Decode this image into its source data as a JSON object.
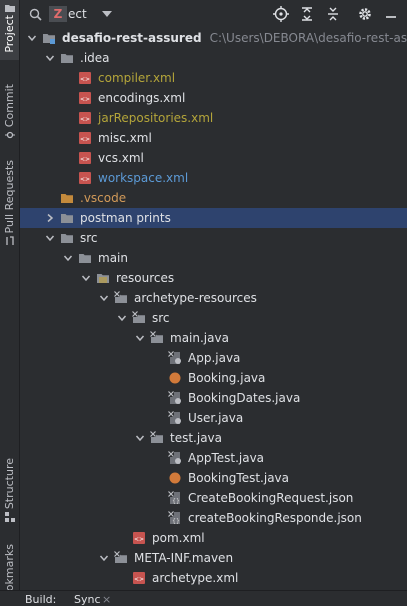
{
  "sidebar": {
    "tabs": [
      {
        "label": "Project",
        "icon": "folder-icon",
        "active": true
      },
      {
        "label": "Commit",
        "icon": "commit-icon",
        "active": false
      },
      {
        "label": "Pull Requests",
        "icon": "pull-request-icon",
        "active": false
      },
      {
        "label": "Structure",
        "icon": "structure-icon",
        "active": false
      },
      {
        "label": "Bookmarks",
        "icon": "bookmark-icon",
        "active": false
      }
    ]
  },
  "header": {
    "badge": "Z",
    "project_select": "ect",
    "icons": [
      "search-icon",
      "locate-icon",
      "expand-all-icon",
      "collapse-all-icon",
      "settings-icon",
      "hide-icon"
    ]
  },
  "tree": [
    {
      "label": "desafio-rest-assured",
      "path": "C:\\Users\\DEBORA\\desafio-rest-assured",
      "icon": "module-folder",
      "style": "bold",
      "depth": 0,
      "expanded": true
    },
    {
      "label": ".idea",
      "icon": "folder",
      "style": "normal",
      "depth": 1,
      "expanded": true
    },
    {
      "label": "compiler.xml",
      "icon": "xml-file",
      "style": "yellow",
      "depth": 2
    },
    {
      "label": "encodings.xml",
      "icon": "xml-file",
      "style": "normal",
      "depth": 2
    },
    {
      "label": "jarRepositories.xml",
      "icon": "xml-file",
      "style": "yellow",
      "depth": 2
    },
    {
      "label": "misc.xml",
      "icon": "xml-file",
      "style": "normal",
      "depth": 2
    },
    {
      "label": "vcs.xml",
      "icon": "xml-file",
      "style": "normal",
      "depth": 2
    },
    {
      "label": "workspace.xml",
      "icon": "xml-file",
      "style": "blue",
      "depth": 2
    },
    {
      "label": ".vscode",
      "icon": "folder",
      "style": "orange",
      "depth": 1,
      "expanded": false,
      "leaf": true
    },
    {
      "label": "postman prints",
      "icon": "folder",
      "style": "normal",
      "depth": 1,
      "expanded": false,
      "selected": true
    },
    {
      "label": "src",
      "icon": "folder",
      "style": "normal",
      "depth": 1,
      "expanded": true
    },
    {
      "label": "main",
      "icon": "folder",
      "style": "normal",
      "depth": 2,
      "expanded": true
    },
    {
      "label": "resources",
      "icon": "resources-folder",
      "style": "normal",
      "depth": 3,
      "expanded": true
    },
    {
      "label": "archetype-resources",
      "icon": "excluded-folder",
      "style": "normal",
      "depth": 4,
      "expanded": true
    },
    {
      "label": "src",
      "icon": "excluded-folder",
      "style": "normal",
      "depth": 5,
      "expanded": true
    },
    {
      "label": "main.java",
      "icon": "excluded-folder",
      "style": "normal",
      "depth": 6,
      "expanded": true
    },
    {
      "label": "App.java",
      "icon": "java-excluded",
      "style": "normal",
      "depth": 7
    },
    {
      "label": "Booking.java",
      "icon": "java-file",
      "style": "normal",
      "depth": 7
    },
    {
      "label": "BookingDates.java",
      "icon": "java-excluded",
      "style": "normal",
      "depth": 7
    },
    {
      "label": "User.java",
      "icon": "java-excluded",
      "style": "normal",
      "depth": 7
    },
    {
      "label": "test.java",
      "icon": "excluded-folder",
      "style": "normal",
      "depth": 6,
      "expanded": true
    },
    {
      "label": "AppTest.java",
      "icon": "java-excluded",
      "style": "normal",
      "depth": 7
    },
    {
      "label": "BookingTest.java",
      "icon": "java-file",
      "style": "normal",
      "depth": 7
    },
    {
      "label": "CreateBookingRequest.json",
      "icon": "json-file",
      "style": "normal",
      "depth": 7
    },
    {
      "label": "createBookingResponde.json",
      "icon": "json-file",
      "style": "normal",
      "depth": 7
    },
    {
      "label": "pom.xml",
      "icon": "xml-file",
      "style": "normal",
      "depth": 5
    },
    {
      "label": "META-INF.maven",
      "icon": "excluded-folder",
      "style": "normal",
      "depth": 4,
      "expanded": true
    },
    {
      "label": "archetype.xml",
      "icon": "xml-file",
      "style": "normal",
      "depth": 5
    }
  ],
  "bottom_bar": {
    "build_label": "Build:",
    "sync_label": "Sync",
    "close_glyph": "×"
  },
  "colors": {
    "background": "#2b2d30",
    "selection": "#2e436e",
    "folder": "#8c9097",
    "vscode_folder": "#c48a3c",
    "xml_icon": "#c75450",
    "java_icon": "#d27a3a",
    "yellow_text": "#b4a53a",
    "blue_text": "#5c9ad6"
  }
}
